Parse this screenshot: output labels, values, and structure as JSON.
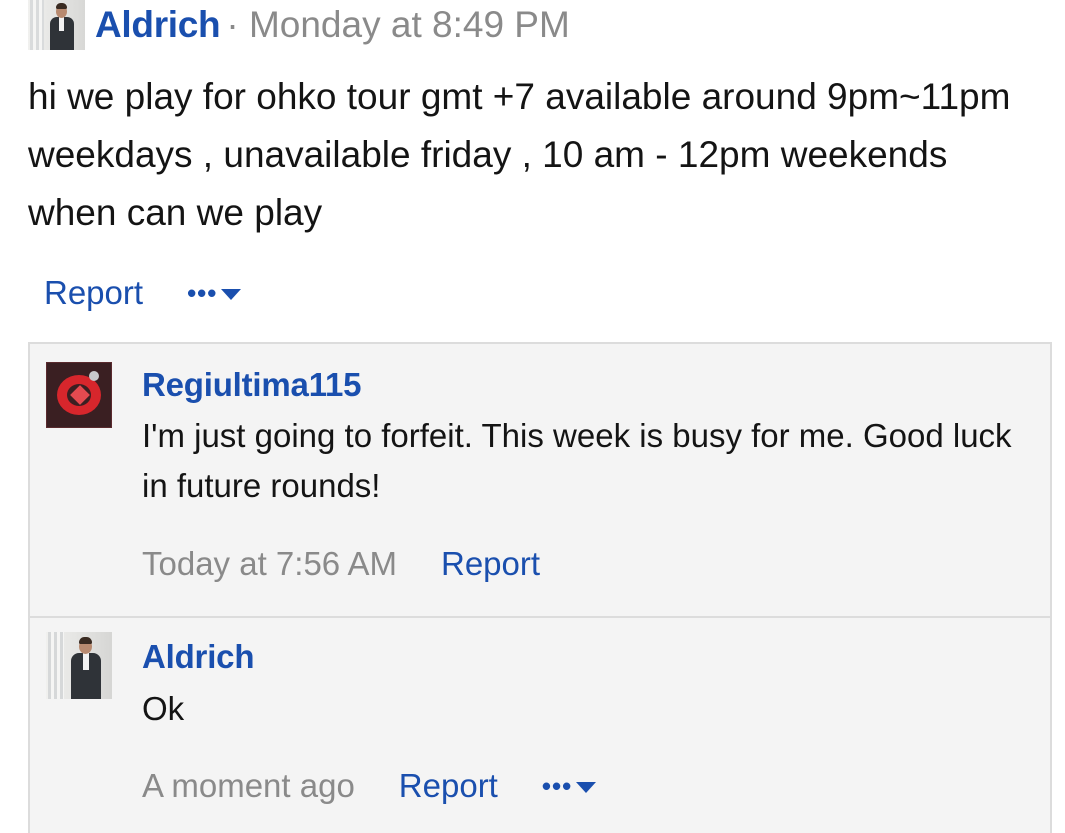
{
  "post": {
    "author": "Aldrich",
    "meta": "· Monday at 8:49 PM",
    "body": "hi we play for ohko tour gmt +7 available around 9pm~11pm weekdays , unavailable friday , 10 am - 12pm weekends when can we play",
    "actions": {
      "report_label": "Report",
      "more_label": "•••"
    }
  },
  "replies": [
    {
      "author": "Regiultima115",
      "text": "I'm just going to forfeit. This week is busy for me. Good luck in future rounds!",
      "timestamp": "Today at 7:56 AM",
      "report_label": "Report"
    },
    {
      "author": "Aldrich",
      "text": "Ok",
      "timestamp": "A moment ago",
      "report_label": "Report",
      "more_label": "•••"
    }
  ],
  "colors": {
    "link": "#1a4fae",
    "meta": "#8a8a8a",
    "text": "#141414",
    "reply_bg": "#f4f4f4",
    "border": "#dcdcdc"
  },
  "icons": {
    "more": "more-options-icon",
    "caret": "chevron-down-icon"
  }
}
